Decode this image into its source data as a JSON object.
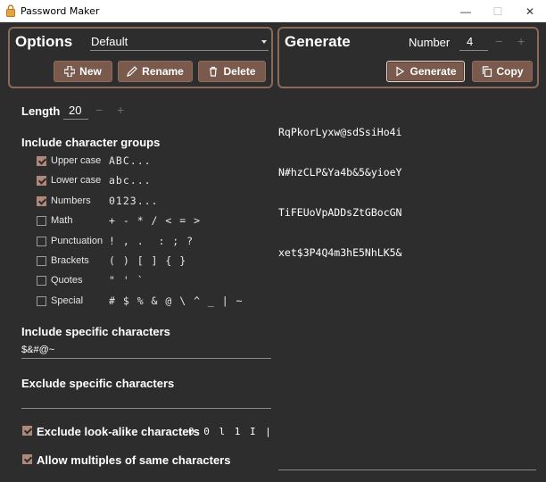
{
  "window": {
    "title": "Password Maker",
    "minimize": "—",
    "maximize": "☐",
    "close": "✕"
  },
  "options": {
    "title": "Options",
    "preset": "Default",
    "new_label": "New",
    "rename_label": "Rename",
    "delete_label": "Delete"
  },
  "generate": {
    "title": "Generate",
    "number_label": "Number",
    "number_value": "4",
    "minus": "−",
    "plus": "+",
    "generate_label": "Generate",
    "copy_label": "Copy"
  },
  "length": {
    "label": "Length",
    "value": "20",
    "minus": "−",
    "plus": "+"
  },
  "groups": {
    "label": "Include character groups",
    "items": [
      {
        "label": "Upper case",
        "sample": "ABC...",
        "checked": true
      },
      {
        "label": "Lower case",
        "sample": "abc...",
        "checked": true
      },
      {
        "label": "Numbers",
        "sample": "0123...",
        "checked": true
      },
      {
        "label": "Math",
        "sample": "+ - * / < = >",
        "checked": false
      },
      {
        "label": "Punctuation",
        "sample": "! , .  : ; ?",
        "checked": false
      },
      {
        "label": "Brackets",
        "sample": "( ) [ ] { }",
        "checked": false
      },
      {
        "label": "Quotes",
        "sample": "\" ' `",
        "checked": false
      },
      {
        "label": "Special",
        "sample": "# $ % & @ \\ ^ _ | ~",
        "checked": false
      }
    ]
  },
  "include_specific": {
    "label": "Include specific characters",
    "value": "$&#@~"
  },
  "exclude_specific": {
    "label": "Exclude specific characters",
    "value": ""
  },
  "exclude_lookalike": {
    "label": "Exclude look-alike characters",
    "chars": "O 0 l 1 I |",
    "checked": true
  },
  "allow_multiples": {
    "label": "Allow multiples of same characters",
    "checked": true
  },
  "passwords": [
    "RqPkorLyxw@sdSsiHo4i",
    "N#hzCLP&Ya4b&5&yioeY",
    "TiFEUoVpADDsZtGBocGN",
    "xet$3P4Q4m3hE5NhLK5&"
  ],
  "colors": {
    "accent": "#7a5a4c",
    "panel_border": "#8c6a5a",
    "background": "#2d2d2d"
  }
}
